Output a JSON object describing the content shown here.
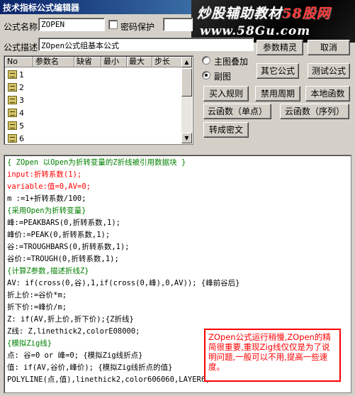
{
  "window": {
    "title": "技术指标公式编辑器"
  },
  "banner": {
    "text_main": "炒股辅助教材",
    "text_red": "58股网",
    "url": "www.58Gu.com"
  },
  "form": {
    "name_label": "公式名称",
    "name_value": "ZOPEN",
    "password_label": "密码保护",
    "password_checked": false,
    "desc_label": "公式描述",
    "desc_value": "ZOpen公式组基本公式"
  },
  "params": {
    "headers": [
      "No",
      "参数名",
      "缺省",
      "最小",
      "最大",
      "步长"
    ],
    "rows": [
      "1",
      "2",
      "3",
      "4",
      "5",
      "6"
    ]
  },
  "options": {
    "overlay_label": "主图叠加",
    "subchart_label": "副图",
    "selected": "副图"
  },
  "buttons": {
    "param_wizard": "参数精灵",
    "cancel": "取消",
    "other_formula": "其它公式",
    "test_formula": "测试公式",
    "buy_rule": "买入规则",
    "disable_period": "禁用周期",
    "local_function": "本地函数",
    "cloud_single": "云函数（单点）",
    "cloud_series": "云函数（序列）",
    "to_cipher": "转成密文"
  },
  "code_lines": [
    {
      "kind": "comment",
      "text": "{ ZOpen 以Open为折转变量的Z折线被引用数据块 }"
    },
    {
      "kind": "kw",
      "text": "input:折转系数(1);"
    },
    {
      "kind": "kw",
      "text": "variable:值=0,AV=0;"
    },
    {
      "kind": "plain",
      "text": "m :=1+折转系数/100;"
    },
    {
      "kind": "comment",
      "text": "{采用Open为折转变量}"
    },
    {
      "kind": "plain",
      "text": "峰:=PEAKBARS(0,折转系数,1);"
    },
    {
      "kind": "plain",
      "text": "峰价:=PEAK(0,折转系数,1);"
    },
    {
      "kind": "plain",
      "text": "谷:=TROUGHBARS(0,折转系数,1);"
    },
    {
      "kind": "plain",
      "text": "谷价:=TROUGH(0,折转系数,1);"
    },
    {
      "kind": "comment",
      "text": "{计算Z参数,描述折线Z}"
    },
    {
      "kind": "plain",
      "text": "AV: if(cross(0,谷),1,if(cross(0,峰),0,AV)); {峰前谷后}"
    },
    {
      "kind": "plain",
      "text": "折上价:=谷价*m;"
    },
    {
      "kind": "plain",
      "text": "折下价:=峰价/m;"
    },
    {
      "kind": "plain",
      "text": "Z: if(AV,折上价,折下价);{Z折线}"
    },
    {
      "kind": "plain",
      "text": "Z线: Z,linethick2,colorE08000;"
    },
    {
      "kind": "comment",
      "text": "{模拟Zig线}"
    },
    {
      "kind": "plain",
      "text": "点: 谷=0 or 峰=0; {模拟Zig线折点}"
    },
    {
      "kind": "plain",
      "text": "值: if(AV,谷价,峰价); {模拟Zig线折点的值}"
    },
    {
      "kind": "plain",
      "text": "POLYLINE(点,值),linethick2,color606060,LAYER6;"
    }
  ],
  "note": "ZOpen公式运行稍慢,ZOpen的精简很重要,重现Zig线仅仅是为了说明问题,一般可以不用,提高一些速度。"
}
